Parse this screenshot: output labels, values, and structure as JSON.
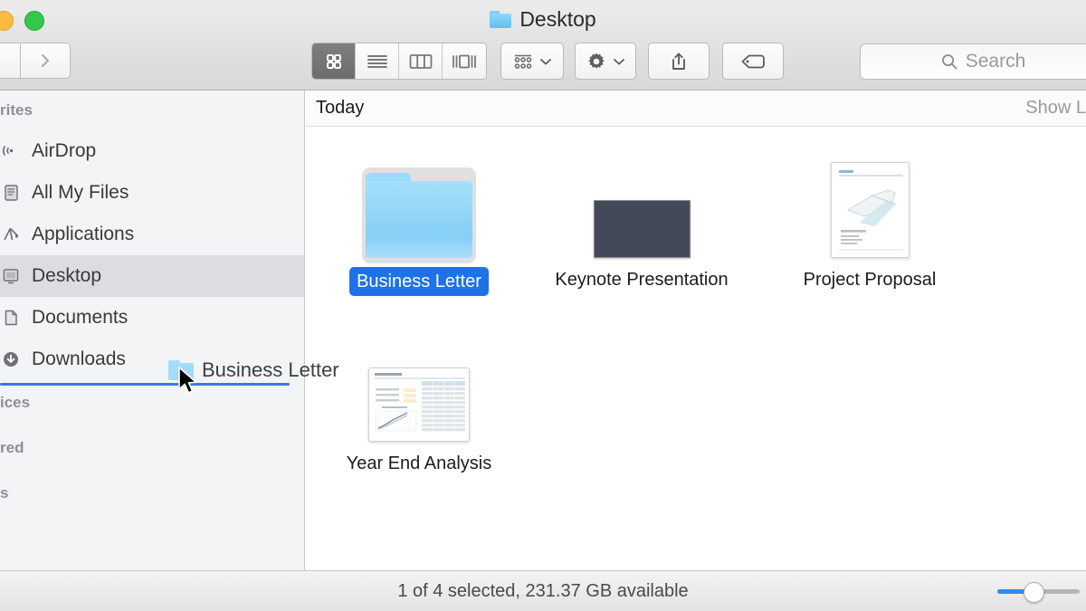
{
  "window": {
    "title": "Desktop",
    "title_icon": "folder-icon",
    "traffic_lights": [
      "yellow-minimize-button",
      "green-zoom-button"
    ]
  },
  "toolbar": {
    "back_button": "back-chevron-icon",
    "forward_button": "forward-chevron-icon",
    "view_modes": [
      {
        "name": "icon-view",
        "icon": "grid-icon",
        "active": true
      },
      {
        "name": "list-view",
        "icon": "list-lines-icon",
        "active": false
      },
      {
        "name": "column-view",
        "icon": "columns-icon",
        "active": false
      },
      {
        "name": "coverflow-view",
        "icon": "coverflow-icon",
        "active": false
      }
    ],
    "arrange_button": {
      "icon": "arrange-grid-icon",
      "chevron": "chevron-down-icon"
    },
    "action_button": {
      "icon": "gear-icon",
      "chevron": "chevron-down-icon"
    },
    "share_button": {
      "icon": "share-upload-icon"
    },
    "tag_button": {
      "icon": "tag-icon"
    }
  },
  "search": {
    "icon": "search-icon",
    "placeholder": "Search",
    "value": ""
  },
  "sidebar": {
    "sections": [
      {
        "header": "Favorites",
        "header_clipped": "rites",
        "items": [
          {
            "label": "AirDrop",
            "icon": "airdrop-icon",
            "selected": false
          },
          {
            "label": "All My Files",
            "icon": "all-my-files-icon",
            "selected": false
          },
          {
            "label": "Applications",
            "icon": "applications-icon",
            "selected": false
          },
          {
            "label": "Desktop",
            "icon": "desktop-icon",
            "selected": true
          },
          {
            "label": "Documents",
            "icon": "documents-icon",
            "selected": false
          },
          {
            "label": "Downloads",
            "icon": "downloads-icon",
            "selected": false
          }
        ]
      },
      {
        "header": "Devices",
        "header_clipped": "ices",
        "items": []
      },
      {
        "header": "Shared",
        "header_clipped": "red",
        "items": []
      },
      {
        "header": "Tags",
        "header_clipped": "s",
        "items": []
      }
    ]
  },
  "drag": {
    "label": "Business Letter",
    "icon": "folder-icon",
    "drop_indicator": "insertion-line",
    "cursor": "arrow-cursor"
  },
  "content": {
    "group": {
      "title": "Today",
      "toggle_label": "Show L",
      "toggle_label_full": "Show Less"
    },
    "files": [
      {
        "name": "Business Letter",
        "kind": "folder",
        "icon": "folder-icon",
        "selected": true
      },
      {
        "name": "Keynote Presentation",
        "kind": "keynote",
        "icon": "keynote-thumbnail",
        "selected": false
      },
      {
        "name": "Project Proposal",
        "kind": "pages",
        "icon": "pages-document-thumbnail",
        "selected": false
      },
      {
        "name": "Year End Analysis",
        "kind": "numbers",
        "icon": "numbers-spreadsheet-thumbnail",
        "selected": false
      }
    ]
  },
  "status": {
    "text": "1 of 4 selected, 231.37 GB available",
    "zoom_percent": 40
  },
  "colors": {
    "selection_blue": "#1d72e8",
    "drop_line_blue": "#3b78e7",
    "slider_blue": "#2f8cf0",
    "folder_blue": "#86cff6",
    "keynote_dark": "#434958"
  }
}
